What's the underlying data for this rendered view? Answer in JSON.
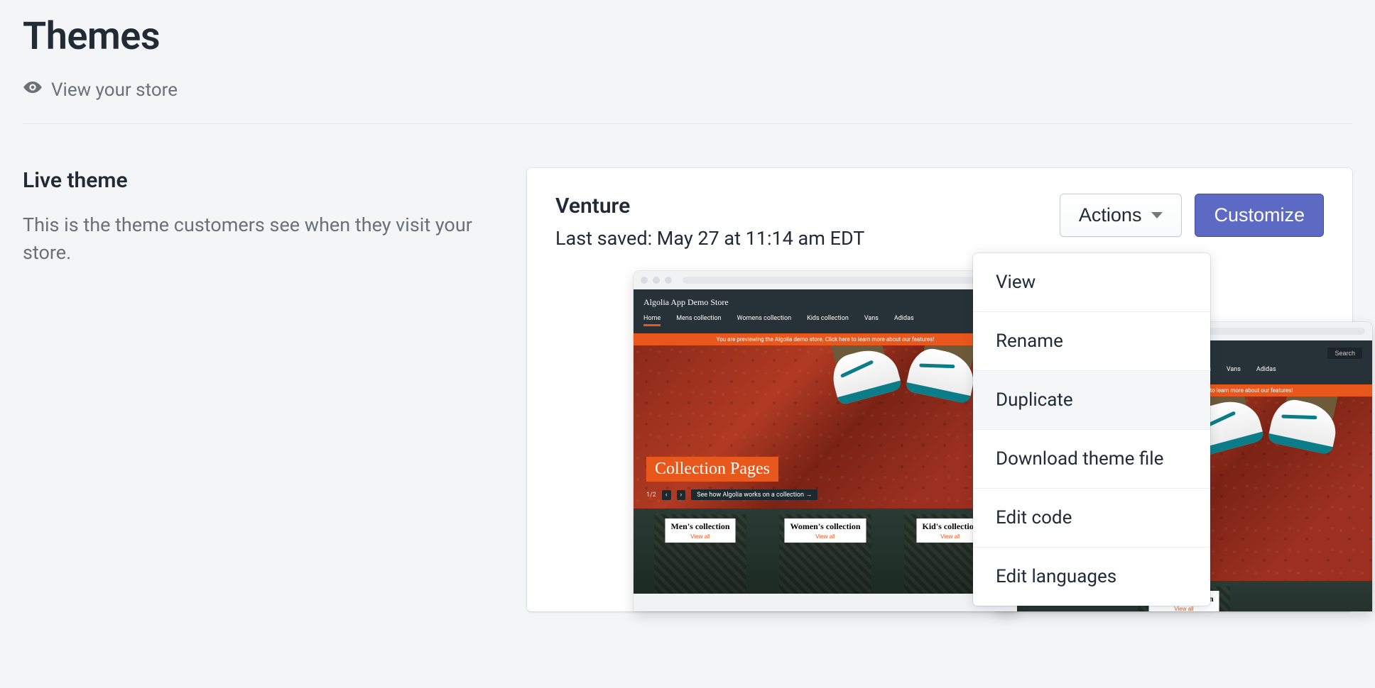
{
  "header": {
    "title": "Themes",
    "view_store_label": "View your store"
  },
  "left": {
    "heading": "Live theme",
    "description": "This is the theme customers see when they visit your store."
  },
  "theme": {
    "name": "Venture",
    "last_saved": "Last saved: May 27 at 11:14 am EDT",
    "actions_label": "Actions",
    "customize_label": "Customize"
  },
  "actions_menu": {
    "items": [
      {
        "label": "View"
      },
      {
        "label": "Rename"
      },
      {
        "label": "Duplicate",
        "hovered": true
      },
      {
        "label": "Download theme file"
      },
      {
        "label": "Edit code"
      },
      {
        "label": "Edit languages"
      }
    ]
  },
  "preview": {
    "brand": "Algolia App Demo Store",
    "search_placeholder": "Search",
    "nav": [
      "Home",
      "Mens collection",
      "Womens collection",
      "Kids collection",
      "Vans",
      "Adidas"
    ],
    "banner": "You are previewing the Algolia demo store. Click here to learn more about our features!",
    "hero_label": "Collection Pages",
    "pager": "1/2",
    "hero_caption": "See how Algolia works on a collection →",
    "collections": [
      {
        "title": "Men's collection",
        "sub": "View all"
      },
      {
        "title": "Women's collection",
        "sub": "View all"
      },
      {
        "title": "Kid's collection",
        "sub": "View all"
      }
    ],
    "back_collection": {
      "title": "Men's collection",
      "sub": "View all"
    }
  }
}
